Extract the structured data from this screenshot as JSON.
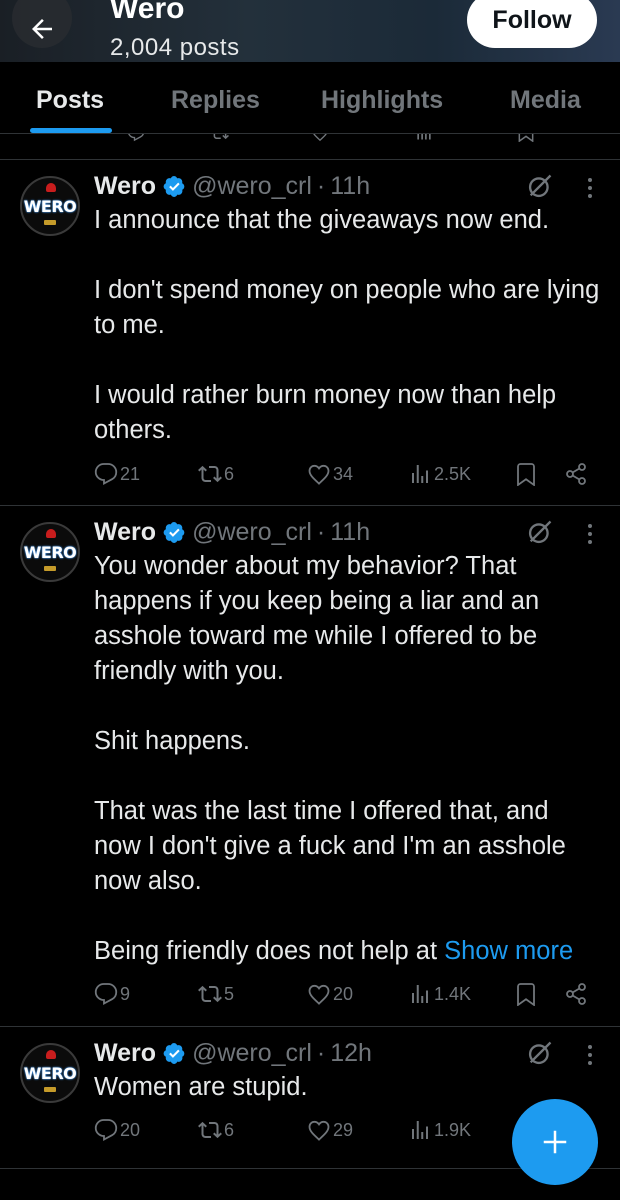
{
  "header": {
    "name": "Wero",
    "posts_count": "2,004 posts",
    "follow_label": "Follow"
  },
  "tabs": [
    {
      "label": "Posts",
      "active": true
    },
    {
      "label": "Replies",
      "active": false
    },
    {
      "label": "Highlights",
      "active": false
    },
    {
      "label": "Media",
      "active": false
    }
  ],
  "colors": {
    "accent": "#1d9bf0",
    "background": "#000000",
    "muted": "#71767b",
    "text": "#e7e9ea"
  },
  "avatar_text": "WERO",
  "posts": [
    {
      "name": "Wero",
      "handle": "@wero_crl",
      "separator": "·",
      "time": "11h",
      "paragraphs": [
        "I announce that the giveaways now end.",
        "I don't spend money on people who are lying to me.",
        "I would rather burn money now than help others."
      ],
      "show_more": "",
      "stats": {
        "replies": "21",
        "reposts": "6",
        "likes": "34",
        "views": "2.5K"
      }
    },
    {
      "name": "Wero",
      "handle": "@wero_crl",
      "separator": "·",
      "time": "11h",
      "paragraphs": [
        "You wonder about my behavior? That happens if you keep being a liar and an asshole toward me while I offered to be friendly with you.",
        "Shit happens.",
        "That was the last time I offered that, and now I don't give a fuck and I'm an asshole now also.",
        "Being friendly does not help at"
      ],
      "show_more": "Show more",
      "stats": {
        "replies": "9",
        "reposts": "5",
        "likes": "20",
        "views": "1.4K"
      }
    },
    {
      "name": "Wero",
      "handle": "@wero_crl",
      "separator": "·",
      "time": "12h",
      "paragraphs": [
        "Women are stupid."
      ],
      "show_more": "",
      "stats": {
        "replies": "20",
        "reposts": "6",
        "likes": "29",
        "views": "1.9K"
      }
    }
  ],
  "icons": [
    "back-arrow-icon",
    "verified-badge-icon",
    "grok-icon",
    "more-icon",
    "reply-icon",
    "repost-icon",
    "like-icon",
    "views-icon",
    "bookmark-icon",
    "share-icon",
    "compose-plus-icon"
  ]
}
